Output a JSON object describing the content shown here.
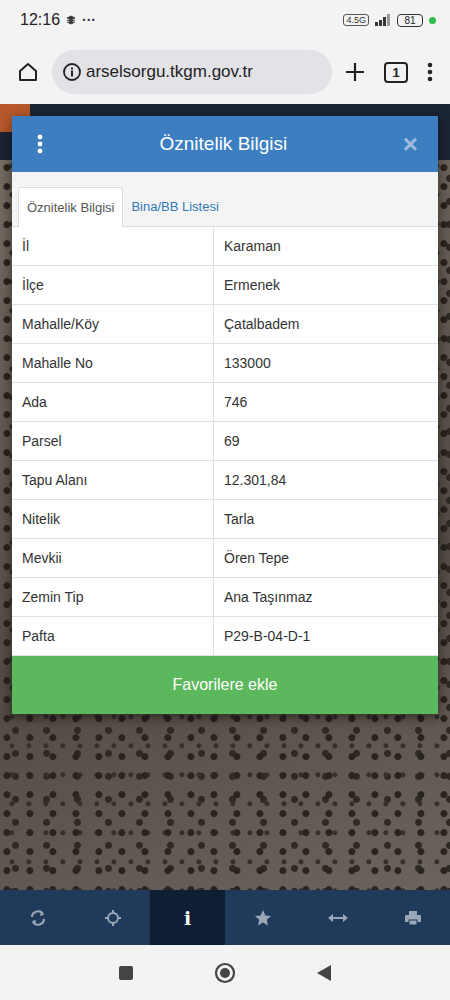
{
  "status_bar": {
    "time": "12:16",
    "dots": "···",
    "network": "4.5G",
    "battery": "81"
  },
  "browser": {
    "url": "arselsorgu.tkgm.gov.tr",
    "tab_count": "1"
  },
  "dialog": {
    "title": "Öznitelik Bilgisi",
    "close": "×",
    "tabs": [
      {
        "label": "Öznitelik Bilgisi",
        "selected": true
      },
      {
        "label": "Bina/BB Listesi",
        "selected": false
      }
    ],
    "rows": [
      {
        "label": "İl",
        "value": "Karaman"
      },
      {
        "label": "İlçe",
        "value": "Ermenek"
      },
      {
        "label": "Mahalle/Köy",
        "value": "Çatalbadem"
      },
      {
        "label": "Mahalle No",
        "value": "133000"
      },
      {
        "label": "Ada",
        "value": "746"
      },
      {
        "label": "Parsel",
        "value": "69"
      },
      {
        "label": "Tapu Alanı",
        "value": "12.301,84"
      },
      {
        "label": "Nitelik",
        "value": "Tarla"
      },
      {
        "label": "Mevkii",
        "value": "Ören Tepe"
      },
      {
        "label": "Zemin Tip",
        "value": "Ana Taşınmaz"
      },
      {
        "label": "Pafta",
        "value": "P29-B-04-D-1"
      }
    ],
    "button": "Favorilere ekle"
  },
  "toolbar": [
    {
      "kind": "refresh",
      "selected": false
    },
    {
      "kind": "locate",
      "selected": false
    },
    {
      "kind": "info",
      "label": "i",
      "selected": true
    },
    {
      "kind": "favorite",
      "selected": false
    },
    {
      "kind": "measure",
      "selected": false
    },
    {
      "kind": "print",
      "selected": false
    }
  ]
}
